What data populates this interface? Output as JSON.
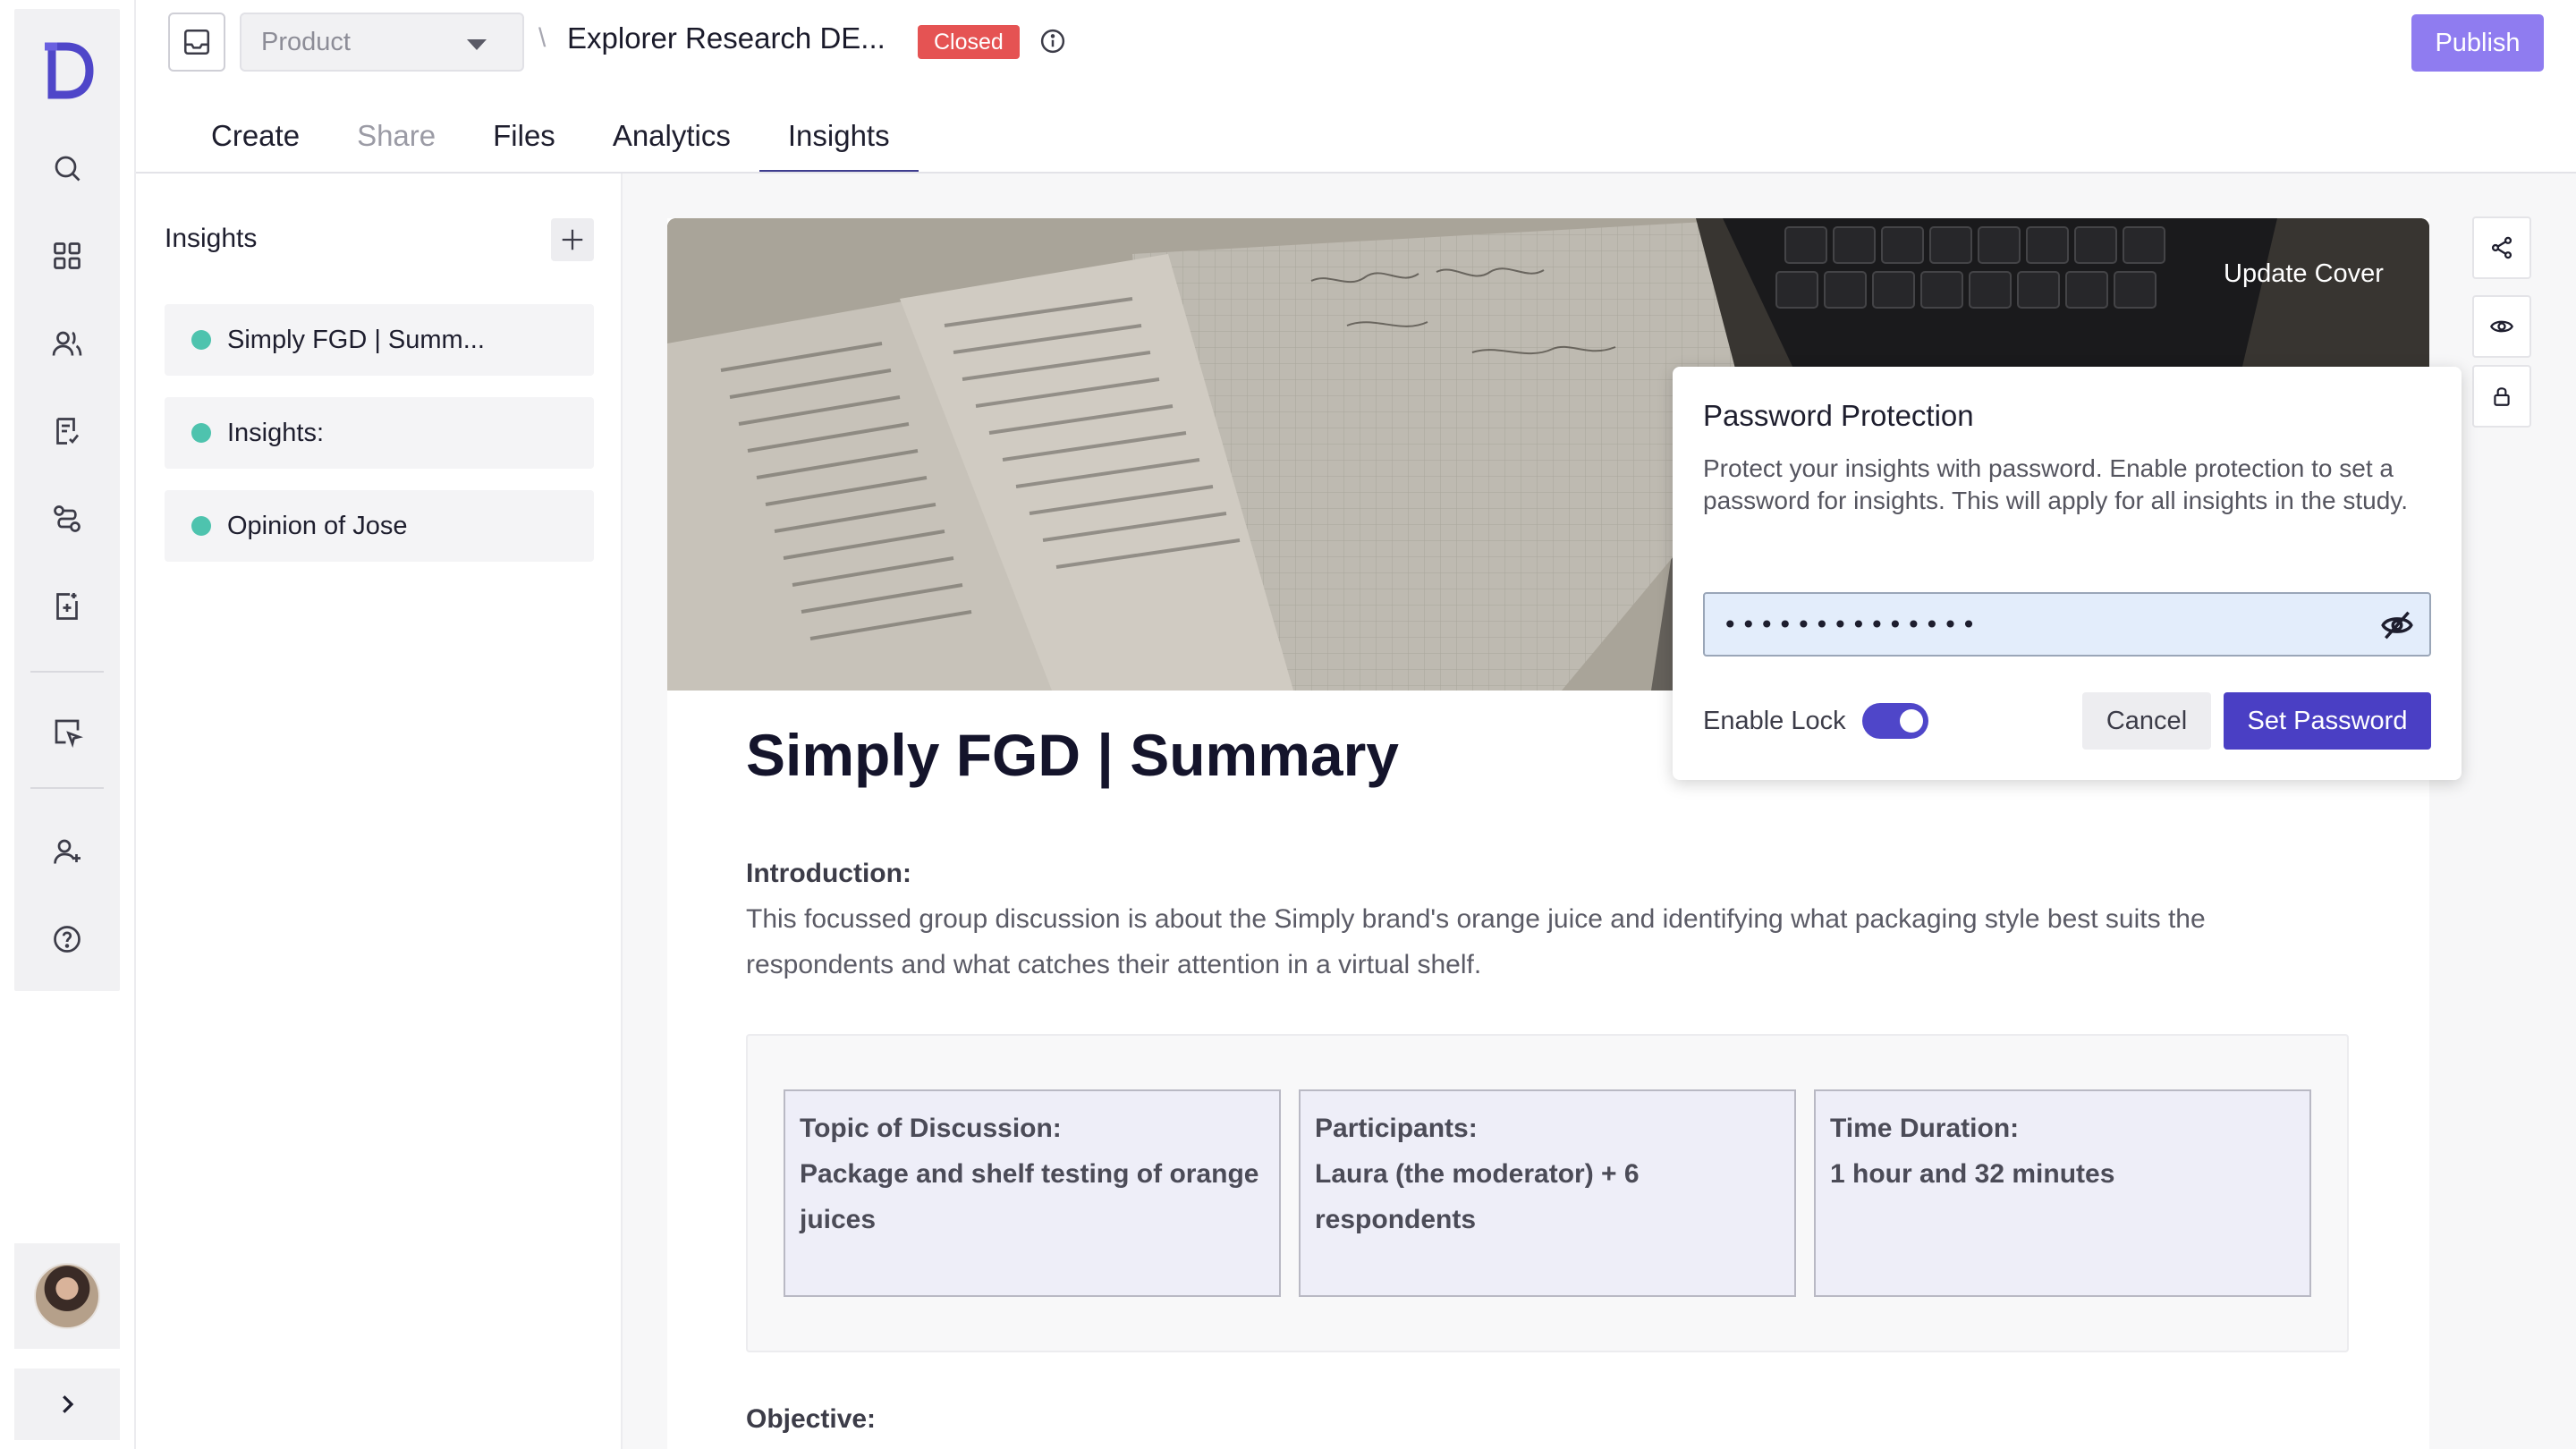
{
  "header": {
    "workspace_select": "Product",
    "breadcrumb_sep": "\\",
    "study_title": "Explorer Research DE...",
    "status_badge": "Closed",
    "publish_label": "Publish"
  },
  "tabs": [
    {
      "label": "Create",
      "state": "normal"
    },
    {
      "label": "Share",
      "state": "disabled"
    },
    {
      "label": "Files",
      "state": "normal"
    },
    {
      "label": "Analytics",
      "state": "normal"
    },
    {
      "label": "Insights",
      "state": "active"
    }
  ],
  "rail": {
    "icons": [
      "search-icon",
      "grid-icon",
      "users-icon",
      "survey-icon",
      "flow-icon",
      "add-page-icon",
      "cursor-icon",
      "add-user-icon",
      "help-icon"
    ],
    "expand_icon": "chevron-right-icon"
  },
  "insights_panel": {
    "title": "Insights",
    "items": [
      {
        "label": "Simply FGD | Summ..."
      },
      {
        "label": "Insights:"
      },
      {
        "label": "Opinion of Jose"
      }
    ],
    "dot_color": "#4ec3ae"
  },
  "document": {
    "update_cover": "Update Cover",
    "title": "Simply FGD | Summary",
    "intro_heading": "Introduction:",
    "intro_text": "This focussed group discussion is about the Simply brand's orange juice and identifying what packaging style best suits the respondents and what catches their attention in a virtual shelf.",
    "cards": [
      {
        "heading": "Topic of Discussion:",
        "body": "Package and shelf testing of orange juices"
      },
      {
        "heading": "Participants:",
        "body": "Laura (the moderator) + 6 respondents"
      },
      {
        "heading": "Time Duration:",
        "body": "1 hour and 32 minutes"
      }
    ],
    "objective_heading": "Objective:"
  },
  "password_popover": {
    "title": "Password Protection",
    "description": "Protect your insights with password. Enable protection to set a password for insights. This will apply for all insights in the study.",
    "password_value": "••••••••••••••",
    "enable_lock_label": "Enable Lock",
    "enable_lock_on": true,
    "cancel_label": "Cancel",
    "set_password_label": "Set Password"
  },
  "colors": {
    "accent": "#4a3fc4",
    "publish": "#8f7cf0",
    "closed": "#e55353"
  }
}
